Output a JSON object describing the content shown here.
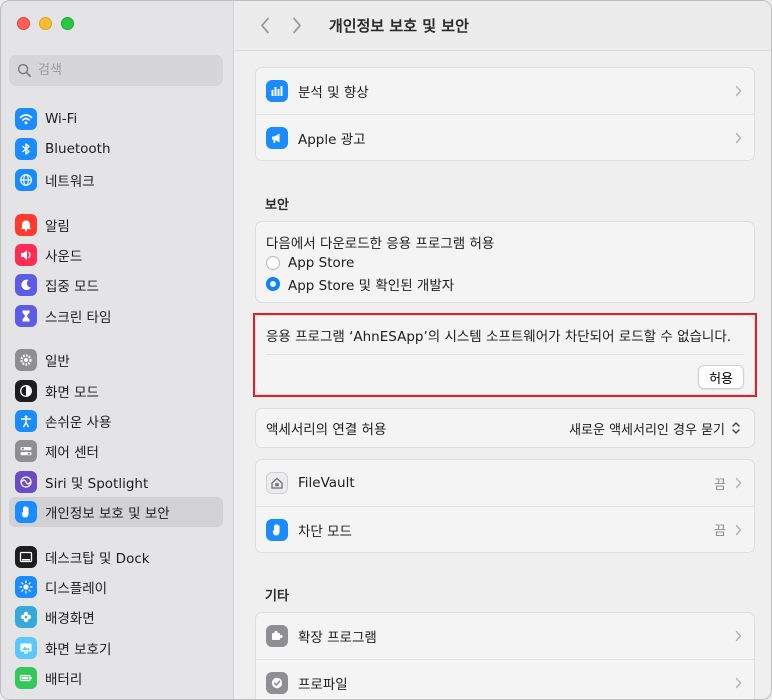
{
  "window": {
    "traffic_colors": [
      "#ff5f57",
      "#febc2e",
      "#28c840"
    ]
  },
  "search": {
    "placeholder": "검색"
  },
  "sidebar": {
    "groups": [
      [
        {
          "label": "Wi-Fi",
          "icon": "wifi-icon",
          "color": "#1a8cff"
        },
        {
          "label": "Bluetooth",
          "icon": "bluetooth-icon",
          "color": "#1a8cff"
        },
        {
          "label": "네트워크",
          "icon": "globe-icon",
          "color": "#1a8cff"
        }
      ],
      [
        {
          "label": "알림",
          "icon": "bell-icon",
          "color": "#ff3b30"
        },
        {
          "label": "사운드",
          "icon": "speaker-icon",
          "color": "#ff2d55"
        },
        {
          "label": "집중 모드",
          "icon": "moon-icon",
          "color": "#5e5ce6"
        },
        {
          "label": "스크린 타임",
          "icon": "hourglass-icon",
          "color": "#5e5ce6"
        }
      ],
      [
        {
          "label": "일반",
          "icon": "gear-icon",
          "color": "#8e8e93"
        },
        {
          "label": "화면 모드",
          "icon": "appearance-icon",
          "color": "#1d1d1f"
        },
        {
          "label": "손쉬운 사용",
          "icon": "accessibility-icon",
          "color": "#1a8cff"
        },
        {
          "label": "제어 센터",
          "icon": "control-center-icon",
          "color": "#8e8e93"
        },
        {
          "label": "Siri 및 Spotlight",
          "icon": "siri-icon",
          "color": "#6b4cc4"
        },
        {
          "label": "개인정보 보호 및 보안",
          "icon": "hand-icon",
          "color": "#1a8cff",
          "active": true
        }
      ],
      [
        {
          "label": "데스크탑 및 Dock",
          "icon": "dock-icon",
          "color": "#1d1d1f"
        },
        {
          "label": "디스플레이",
          "icon": "sun-icon",
          "color": "#1a8cff"
        },
        {
          "label": "배경화면",
          "icon": "flower-icon",
          "color": "#34aadc"
        },
        {
          "label": "화면 보호기",
          "icon": "screensaver-icon",
          "color": "#5ac8fa"
        },
        {
          "label": "배터리",
          "icon": "battery-icon",
          "color": "#34c759"
        }
      ]
    ]
  },
  "header": {
    "title": "개인정보 보호 및 보안"
  },
  "privacy": {
    "analytics_label": "분석 및 향상",
    "ads_label": "Apple 광고"
  },
  "security": {
    "section_label": "보안",
    "downloads_title": "다음에서 다운로드한 응용 프로그램 허용",
    "option_appstore": "App Store",
    "option_appstore_dev": "App Store 및 확인된 개발자",
    "selected": "App Store 및 확인된 개발자",
    "blocked_message": "응용 프로그램 ‘AhnESApp’의 시스템 소프트웨어가 차단되어 로드할 수 없습니다.",
    "allow_button": "허용",
    "accessory_label": "액세서리의 연결 허용",
    "accessory_value": "새로운 액세서리인 경우 묻기",
    "filevault_label": "FileVault",
    "filevault_value": "끔",
    "lockdown_label": "차단 모드",
    "lockdown_value": "끔"
  },
  "other": {
    "section_label": "기타",
    "extensions_label": "확장 프로그램",
    "profiles_label": "프로파일"
  },
  "colors": {
    "accent": "#0a84ff",
    "highlight_border": "#e11d2a"
  }
}
